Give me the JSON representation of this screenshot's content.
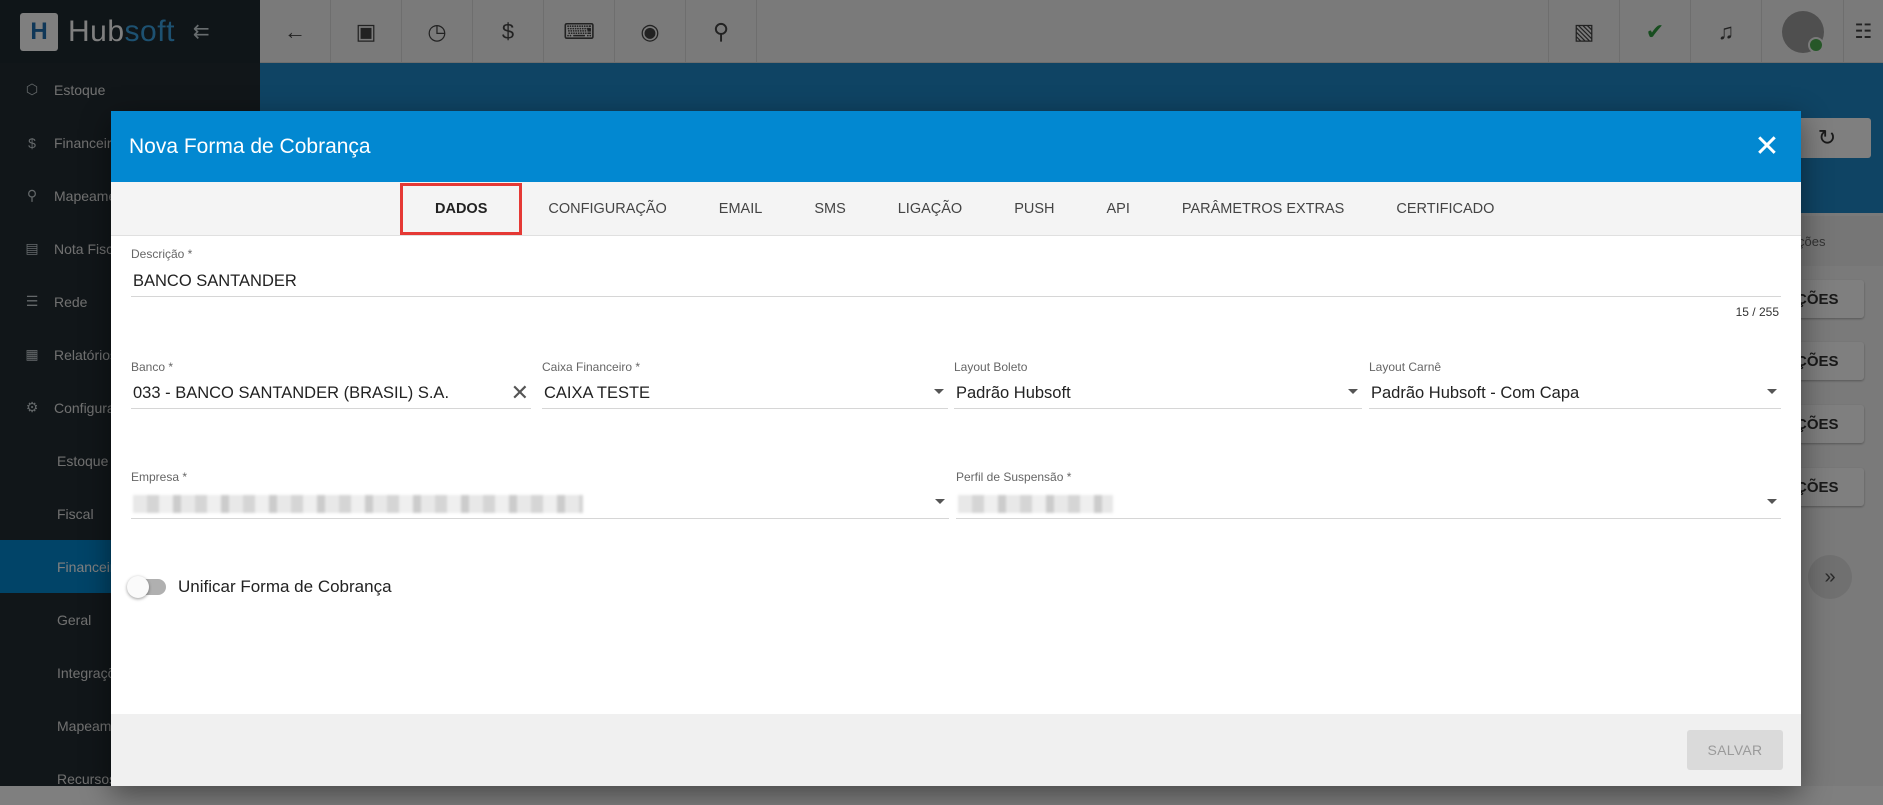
{
  "app": {
    "logo_letter": "H",
    "logo_hub": "Hub",
    "logo_soft": "soft"
  },
  "sidebar": {
    "items": [
      {
        "label": "Estoque",
        "icon": "cube-icon"
      },
      {
        "label": "Financeiro",
        "icon": "money-icon"
      },
      {
        "label": "Mapeamento",
        "icon": "map-pin-icon"
      },
      {
        "label": "Nota Fiscal",
        "icon": "document-icon"
      },
      {
        "label": "Rede",
        "icon": "server-icon"
      },
      {
        "label": "Relatórios",
        "icon": "report-icon"
      },
      {
        "label": "Configurações",
        "icon": "gear-icon"
      }
    ],
    "subitems": [
      "Estoque",
      "Fiscal",
      "Financeiro",
      "Geral",
      "Integrações",
      "Mapeamento",
      "Recursos"
    ]
  },
  "background": {
    "tab_label": "ções",
    "row_button_label": "ÇÕES"
  },
  "modal": {
    "title": "Nova Forma de Cobrança",
    "tabs": [
      "DADOS",
      "CONFIGURAÇÃO",
      "EMAIL",
      "SMS",
      "LIGAÇÃO",
      "PUSH",
      "API",
      "PARÂMETROS EXTRAS",
      "CERTIFICADO"
    ],
    "descricao": {
      "label": "Descrição *",
      "value": "BANCO SANTANDER",
      "counter": "15 / 255"
    },
    "banco": {
      "label": "Banco *",
      "value": "033 - BANCO SANTANDER (BRASIL) S.A."
    },
    "caixa": {
      "label": "Caixa Financeiro *",
      "value": "CAIXA TESTE"
    },
    "layout_boleto": {
      "label": "Layout Boleto",
      "value": "Padrão Hubsoft"
    },
    "layout_carne": {
      "label": "Layout Carnê",
      "value": "Padrão Hubsoft - Com Capa"
    },
    "empresa": {
      "label": "Empresa *"
    },
    "perfil": {
      "label": "Perfil de Suspensão *"
    },
    "unificar": {
      "label": "Unificar Forma de Cobrança",
      "enabled": false
    },
    "save_label": "SALVAR"
  }
}
